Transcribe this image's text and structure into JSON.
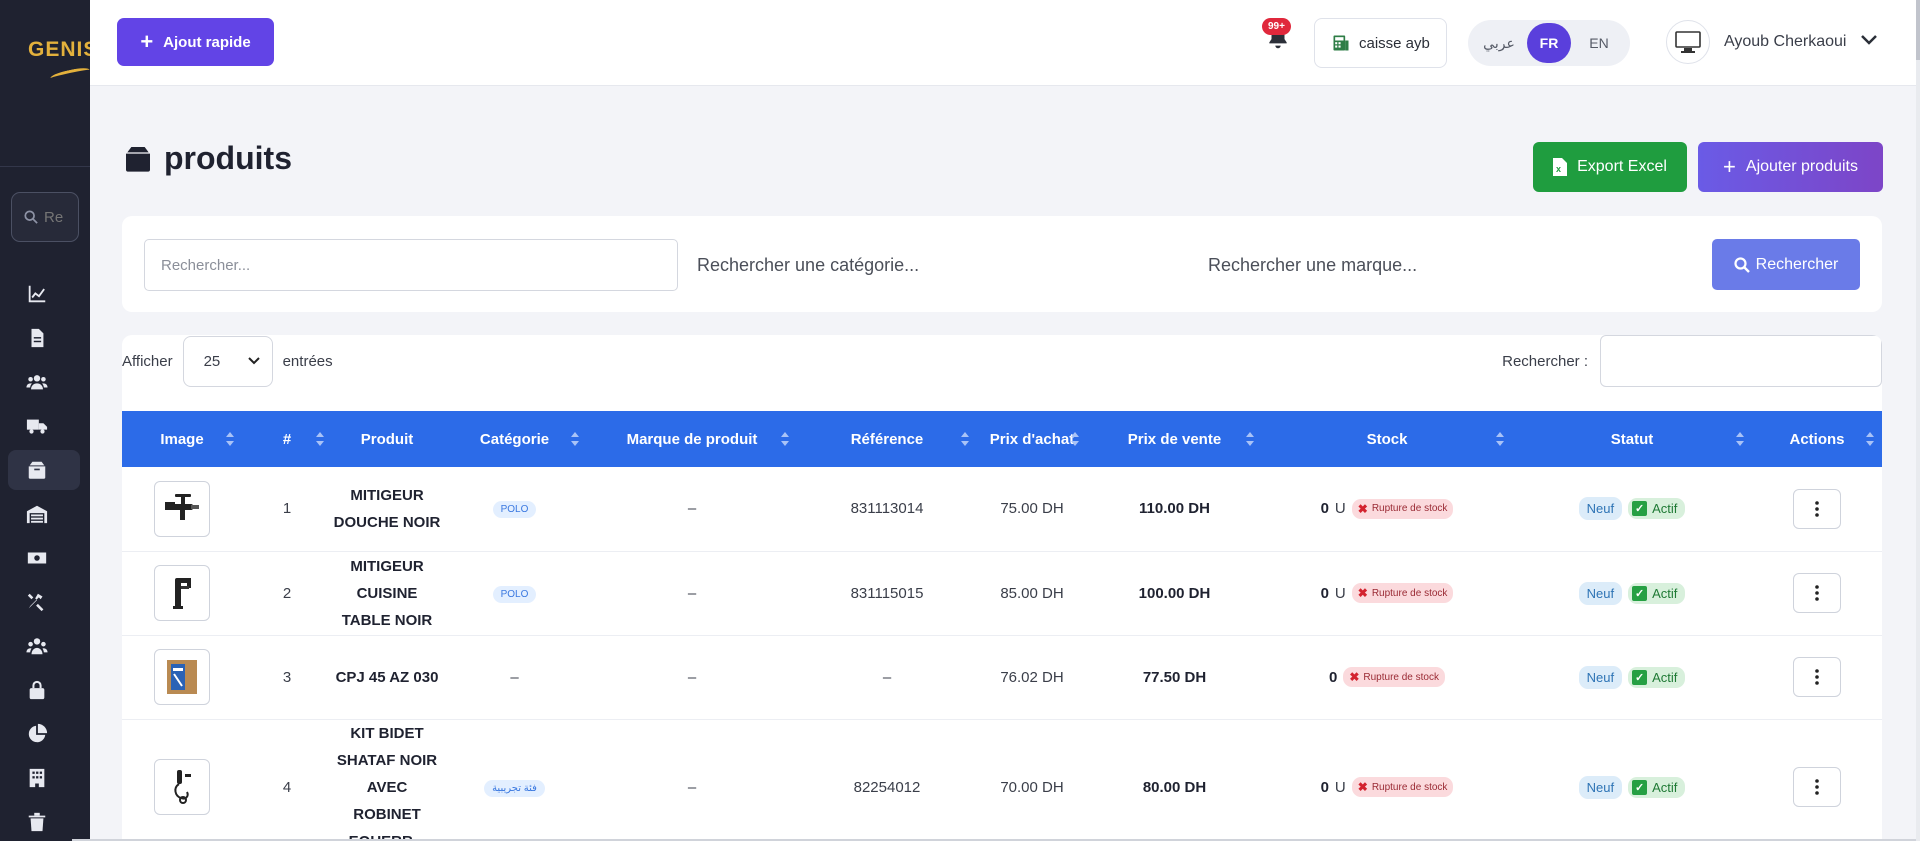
{
  "sidebar": {
    "logo_text": "GENIS",
    "search_placeholder": "Re"
  },
  "header": {
    "quick_add_label": "Ajout rapide",
    "notification_count": "99+",
    "register_label": "caisse ayb",
    "lang": {
      "ar": "عربي",
      "fr": "FR",
      "en": "EN",
      "active": "FR"
    },
    "user_name": "Ayoub Cherkaoui"
  },
  "page": {
    "title": "produits",
    "export_label": "Export Excel",
    "add_label": "Ajouter produits"
  },
  "filters": {
    "search_placeholder": "Rechercher...",
    "category_placeholder": "Rechercher une catégorie...",
    "brand_placeholder": "Rechercher une marque...",
    "search_button": "Rechercher"
  },
  "table_controls": {
    "show_label": "Afficher",
    "page_size": "25",
    "entries_label": "entrées",
    "search_label": "Rechercher :"
  },
  "table": {
    "columns": [
      "Image",
      "#",
      "Produit",
      "Catégorie",
      "Marque de produit",
      "Référence",
      "Prix d'achat",
      "Prix de vente",
      "Stock",
      "Statut",
      "Actions"
    ],
    "rows": [
      {
        "num": "1",
        "product": "MITIGEUR DOUCHE NOIR",
        "category": "POLO",
        "brand": "–",
        "reference": "831113014",
        "buy_price": "75.00 DH",
        "sell_price": "110.00 DH",
        "stock_qty": "0",
        "stock_unit": "U",
        "stock_status": "Rupture de stock",
        "condition": "Neuf",
        "status": "Actif",
        "image_icon": "shower-mixer-icon"
      },
      {
        "num": "2",
        "product": "MITIGEUR CUISINE TABLE NOIR",
        "category": "POLO",
        "brand": "–",
        "reference": "831115015",
        "buy_price": "85.00 DH",
        "sell_price": "100.00 DH",
        "stock_qty": "0",
        "stock_unit": "U",
        "stock_status": "Rupture de stock",
        "condition": "Neuf",
        "status": "Actif",
        "image_icon": "kitchen-faucet-icon"
      },
      {
        "num": "3",
        "product": "CPJ 45 AZ 030",
        "category": "–",
        "brand": "–",
        "reference": "–",
        "buy_price": "76.02 DH",
        "sell_price": "77.50 DH",
        "stock_qty": "0",
        "stock_unit": "",
        "stock_status": "Rupture de stock",
        "condition": "Neuf",
        "status": "Actif",
        "image_icon": "product-box-icon"
      },
      {
        "num": "4",
        "product": "KIT BIDET SHATAF NOIR AVEC ROBINET EQUERR...",
        "category": "فئة تجريبية",
        "brand": "–",
        "reference": "82254012",
        "buy_price": "70.00 DH",
        "sell_price": "80.00 DH",
        "stock_qty": "0",
        "stock_unit": "U",
        "stock_status": "Rupture de stock",
        "condition": "Neuf",
        "status": "Actif",
        "image_icon": "bidet-shataf-icon"
      }
    ]
  },
  "colors": {
    "sidebar_bg": "#1f2230",
    "primary": "#6244e6",
    "table_header": "#2c6be8",
    "export_green": "#1f9d3f",
    "danger": "#e0283c"
  }
}
